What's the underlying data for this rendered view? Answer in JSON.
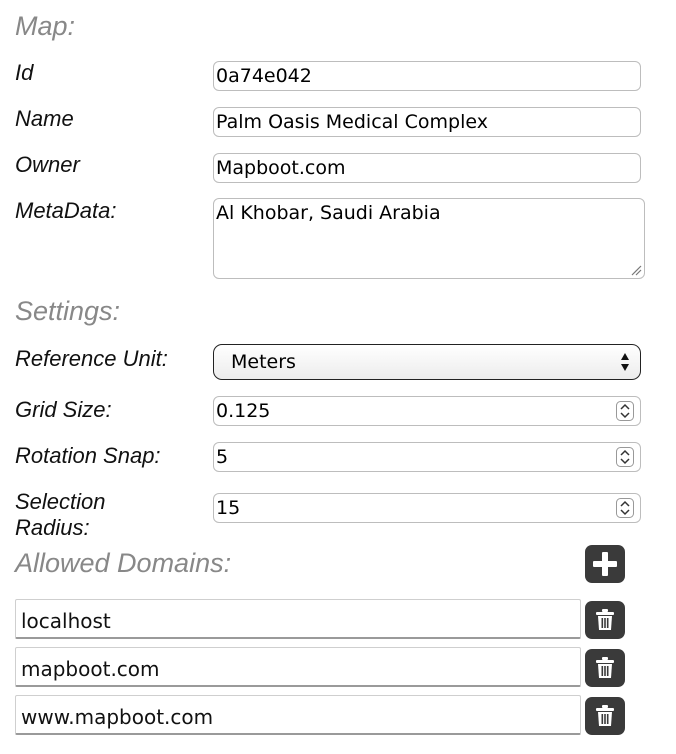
{
  "map_section": {
    "title": "Map:",
    "id_label": "Id",
    "id_value": "0a74e042",
    "name_label": "Name",
    "name_value": "Palm Oasis Medical Complex",
    "owner_label": "Owner",
    "owner_value": "Mapboot.com",
    "metadata_label": "MetaData:",
    "metadata_value": "Al Khobar, Saudi Arabia"
  },
  "settings_section": {
    "title": "Settings:",
    "reference_unit_label": "Reference Unit:",
    "reference_unit_value": "Meters",
    "grid_size_label": "Grid Size:",
    "grid_size_value": "0.125",
    "rotation_snap_label": "Rotation Snap:",
    "rotation_snap_value": "5",
    "selection_radius_label_line1": "Selection",
    "selection_radius_label_line2": "Radius:",
    "selection_radius_value": "15"
  },
  "domains_section": {
    "title": "Allowed Domains:",
    "add_icon": "plus-icon",
    "delete_icon": "trash-icon",
    "domains": [
      "localhost",
      "mapboot.com",
      "www.mapboot.com"
    ]
  },
  "colors": {
    "section_title": "#888888",
    "button_bg": "#3a3a3a",
    "input_border": "#bdbdbd"
  }
}
